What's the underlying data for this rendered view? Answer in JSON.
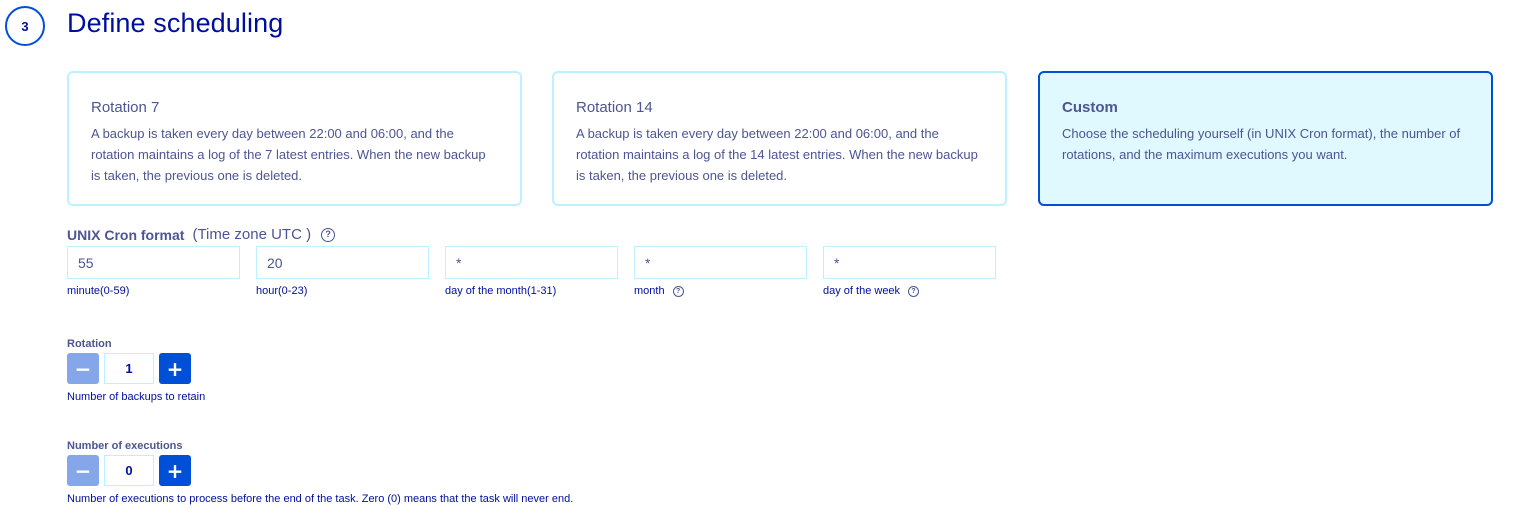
{
  "step": {
    "number": "3",
    "title": "Define scheduling"
  },
  "tiles": [
    {
      "title": "Rotation 7",
      "description": "A backup is taken every day between 22:00 and 06:00, and the rotation maintains a log of the 7 latest entries. When the new backup is taken, the previous one is deleted."
    },
    {
      "title": "Rotation 14",
      "description": "A backup is taken every day between 22:00 and 06:00, and the rotation maintains a log of the 14 latest entries. When the new backup is taken, the previous one is deleted."
    },
    {
      "title": "Custom",
      "description": "Choose the scheduling yourself (in UNIX Cron format), the number of rotations, and the maximum executions you want.",
      "selected": true
    }
  ],
  "cron": {
    "label": "UNIX Cron format",
    "timezone": "(Time zone UTC )",
    "help_icon": "question-circle-icon",
    "fields": [
      {
        "value": "55",
        "caption": "minute(0-59)"
      },
      {
        "value": "20",
        "caption": "hour(0-23)"
      },
      {
        "value": "*",
        "caption": "day of the month(1-31)"
      },
      {
        "value": "*",
        "caption": "month"
      },
      {
        "value": "*",
        "caption": "day of the week"
      }
    ]
  },
  "rotation": {
    "label": "Rotation",
    "value": "1",
    "minus": "−",
    "plus": "+",
    "help": "Number of backups to retain"
  },
  "executions": {
    "label": "Number of executions",
    "value": "0",
    "minus": "−",
    "plus": "+",
    "help": "Number of executions to process before the end of the task. Zero (0) means that the task will never end."
  },
  "colors": {
    "primary": "#0050d7",
    "text_dark": "#000e9c",
    "text_muted": "#4d5592",
    "tile_border": "#bef1ff",
    "tile_selected_bg": "#e0f8ff",
    "button_disabled": "#85a6e9"
  }
}
